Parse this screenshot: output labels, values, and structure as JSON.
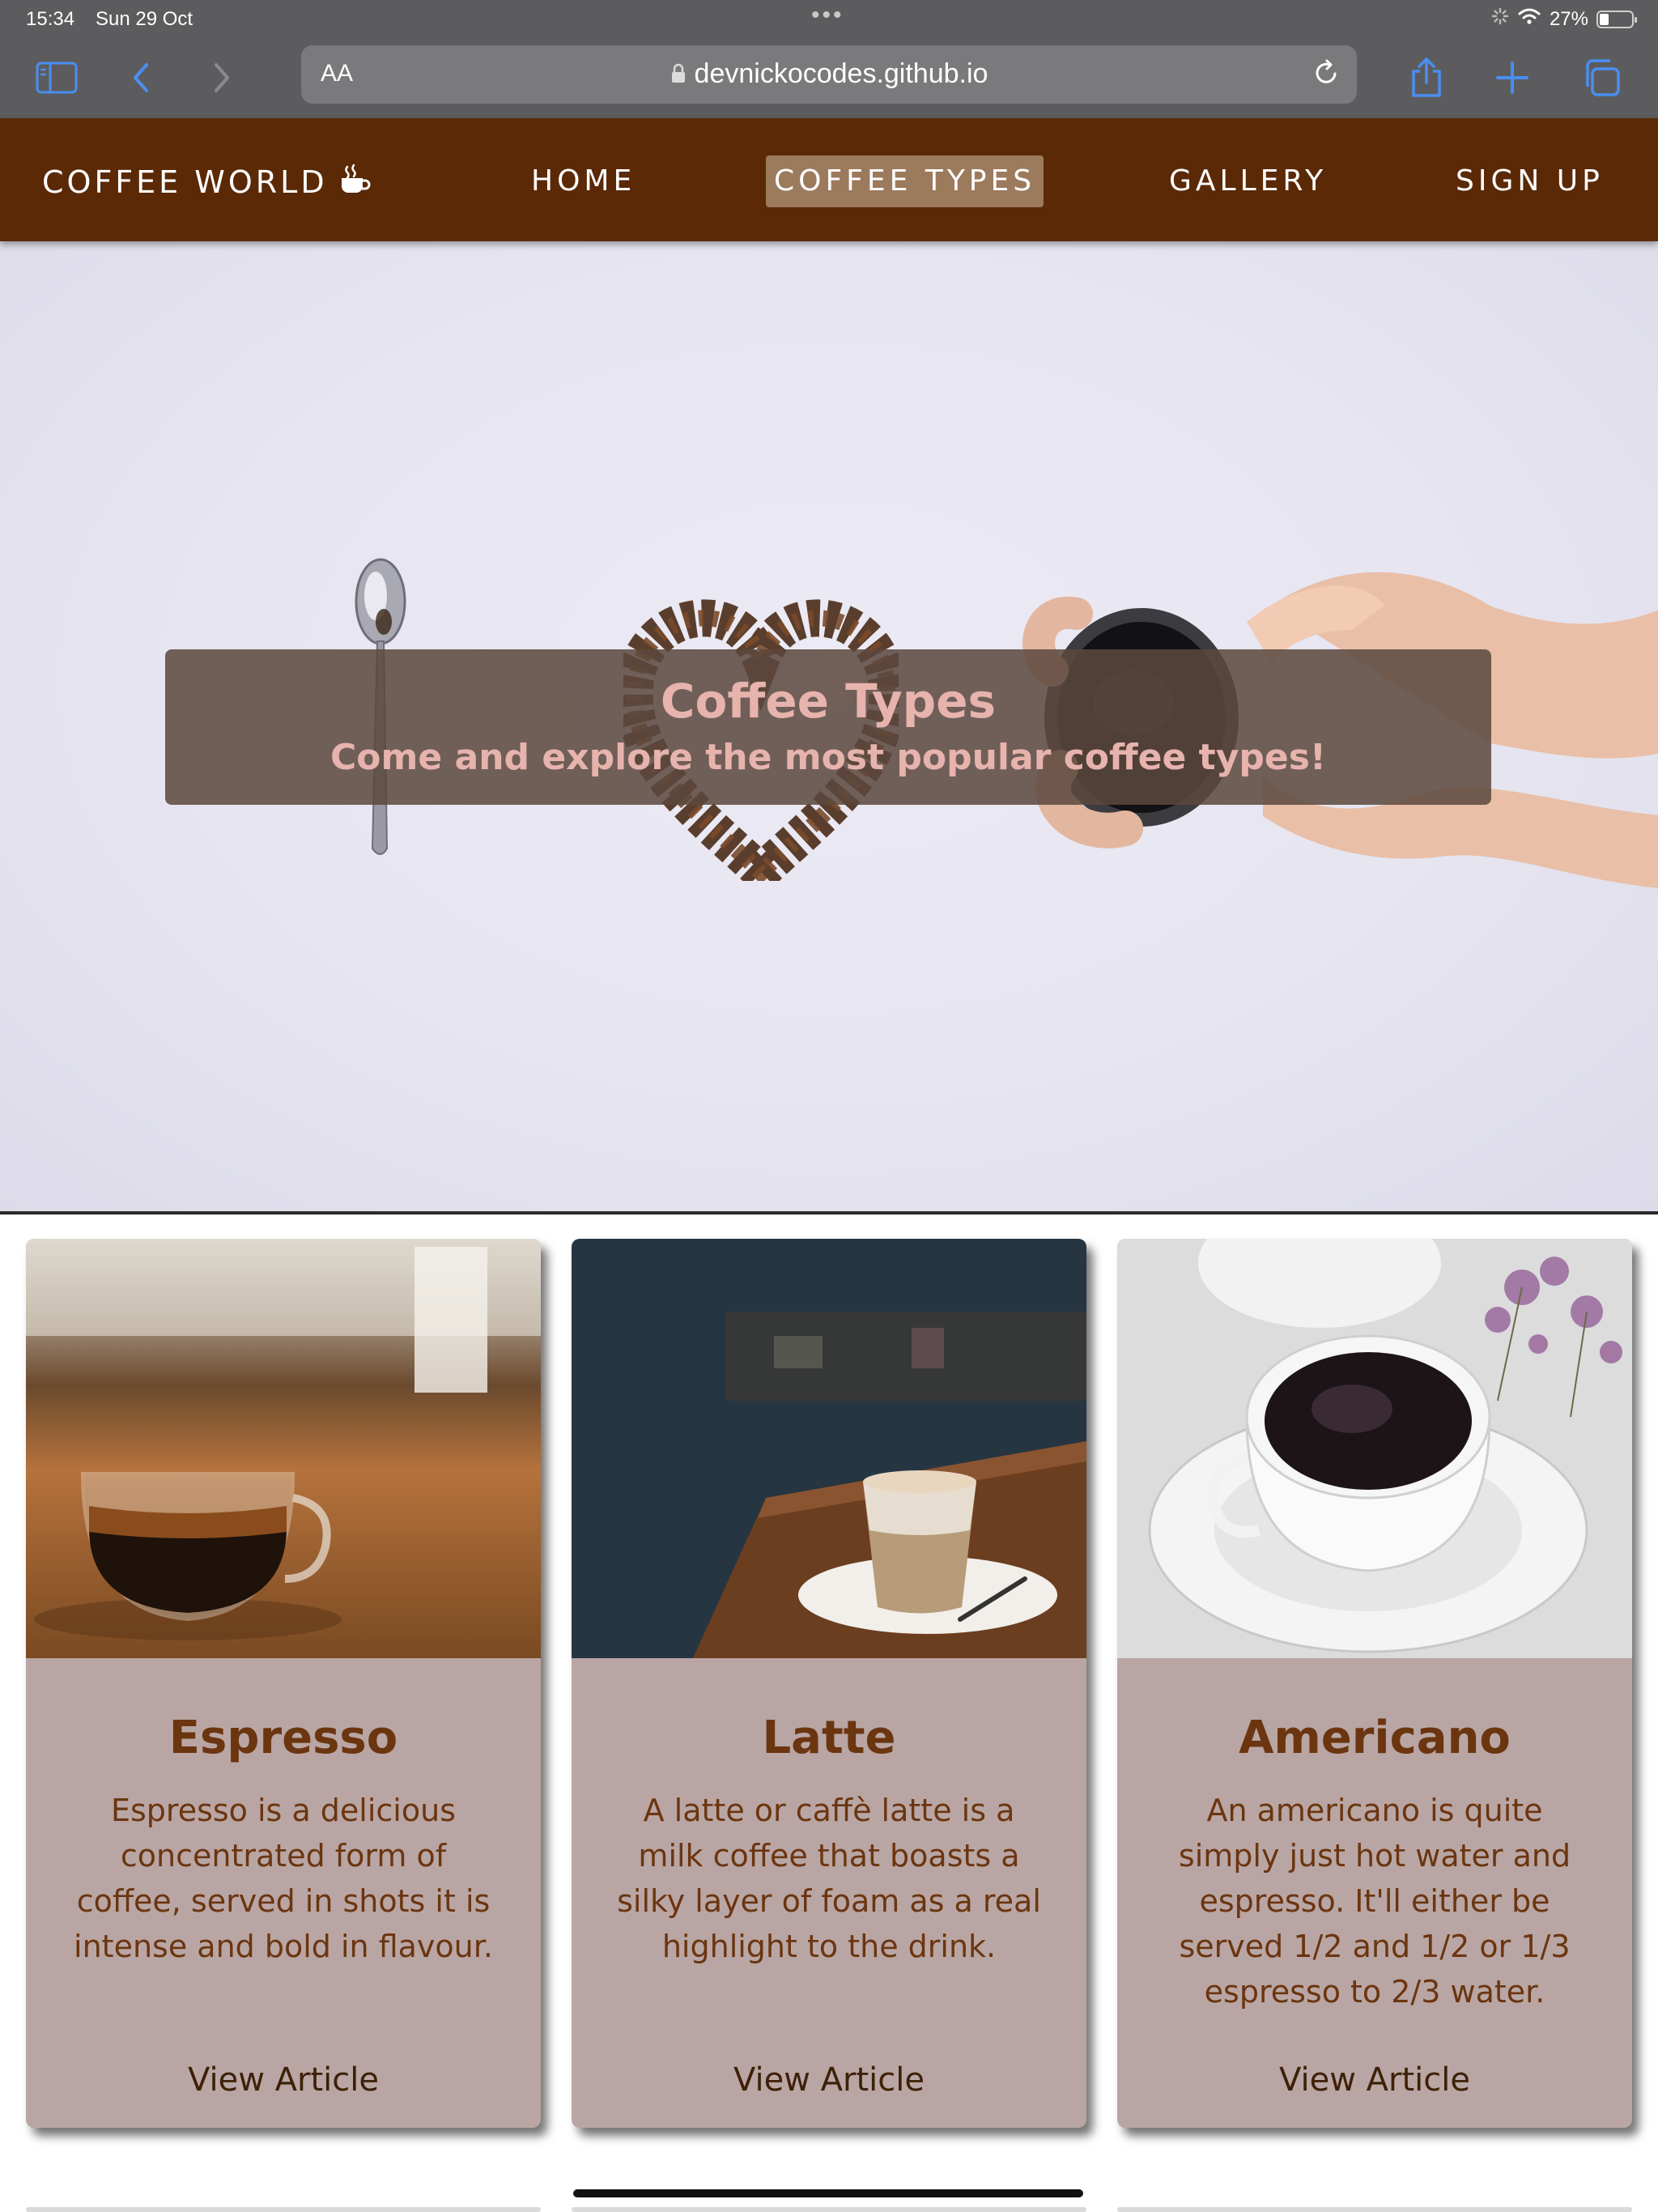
{
  "status_bar": {
    "time": "15:34",
    "date": "Sun 29 Oct",
    "battery": "27%"
  },
  "browser": {
    "text_size_button": "AA",
    "url": "devnickocodes.github.io",
    "icons": [
      "sidebar-icon",
      "back-icon",
      "forward-icon",
      "lock-icon",
      "reload-icon",
      "share-icon",
      "new-tab-icon",
      "tabs-icon"
    ]
  },
  "nav": {
    "brand": "COFFEE WORLD",
    "links": [
      "HOME",
      "COFFEE TYPES",
      "GALLERY",
      "SIGN UP"
    ],
    "active": "COFFEE TYPES"
  },
  "hero": {
    "title": "Coffee Types",
    "subtitle": "Come and explore the most popular coffee types!"
  },
  "cards": [
    {
      "title": "Espresso",
      "description": "Espresso is a delicious concentrated form of coffee, served in shots it is intense and bold in flavour.",
      "link": "View Article"
    },
    {
      "title": "Latte",
      "description": "A latte or caffè latte is a milk coffee that boasts a silky layer of foam as a real highlight to the drink.",
      "link": "View Article"
    },
    {
      "title": "Americano",
      "description": "An americano is quite simply just hot water and espresso. It'll either be served 1/2 and 1/2 or 1/3 espresso to 2/3 water.",
      "link": "View Article"
    }
  ],
  "colors": {
    "nav_background": "#5b2906",
    "nav_active": "#9c7a5c",
    "card_background": "#b9a6a4",
    "card_text": "#6b3510",
    "hero_text": "#e7b3ad"
  }
}
